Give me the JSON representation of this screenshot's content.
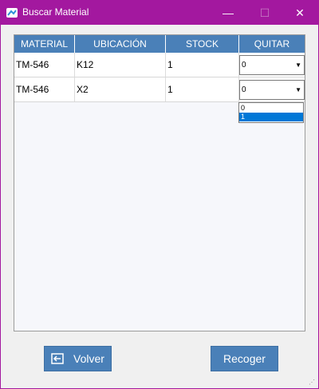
{
  "window": {
    "title": "Buscar Material"
  },
  "table": {
    "columns": [
      "MATERIAL",
      "UBICACIÓN",
      "STOCK",
      "QUITAR"
    ],
    "rows": [
      {
        "material": "TM-546",
        "ubicacion": "K12",
        "stock": "1",
        "quitar": "0"
      },
      {
        "material": "TM-546",
        "ubicacion": "X2",
        "stock": "1",
        "quitar": "0"
      }
    ]
  },
  "dropdown": {
    "options": [
      "0",
      "1"
    ],
    "selected": "1"
  },
  "buttons": {
    "volver": "Volver",
    "recoger": "Recoger"
  },
  "colors": {
    "titlebar": "#a3189f",
    "header": "#4a80b8",
    "button": "#4a80b8",
    "selection": "#0078d7"
  }
}
